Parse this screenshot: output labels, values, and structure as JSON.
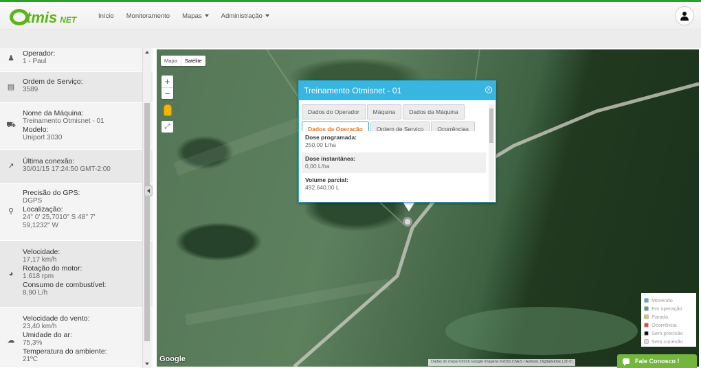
{
  "header": {
    "logo_main": "tmis",
    "logo_suffix": "NET",
    "nav": [
      {
        "label": "Início",
        "has_caret": false
      },
      {
        "label": "Monitoramento",
        "has_caret": false
      },
      {
        "label": "Mapas",
        "has_caret": true
      },
      {
        "label": "Administração",
        "has_caret": true
      }
    ],
    "user_icon": "user-icon"
  },
  "sidebar": {
    "sections": [
      {
        "icon": "operator-icon",
        "fields": [
          {
            "label": "Operador:",
            "value": "1 - Paul"
          }
        ]
      },
      {
        "icon": "document-icon",
        "fields": [
          {
            "label": "Ordem de Serviço:",
            "value": "3589"
          }
        ]
      },
      {
        "icon": "tractor-icon",
        "fields": [
          {
            "label": "Nome da Máquina:",
            "value": "Treinamento Otmisnet - 01"
          },
          {
            "label": "Modelo:",
            "value": "Uniport 3030"
          }
        ]
      },
      {
        "icon": "connection-icon",
        "fields": [
          {
            "label": "Última conexão:",
            "value": "30/01/15 17:24:50 GMT-2:00"
          }
        ]
      },
      {
        "icon": "location-pin-icon",
        "fields": [
          {
            "label": "Precisão do GPS:",
            "value": "DGPS"
          },
          {
            "label": "Localização:",
            "value": "24° 0' 25,7010\" S 48° 7' 59,1232\" W"
          }
        ]
      },
      {
        "icon": "gauge-icon",
        "fields": [
          {
            "label": "Velocidade:",
            "value": "17,17 km/h"
          },
          {
            "label": "Rotação do motor:",
            "value": "1.618 rpm"
          },
          {
            "label": "Consumo de combustível:",
            "value": "8,90 L/h"
          }
        ]
      },
      {
        "icon": "weather-icon",
        "fields": [
          {
            "label": "Velocidade do vento:",
            "value": "23,40 km/h"
          },
          {
            "label": "Umidade do ar:",
            "value": "75,3%"
          },
          {
            "label": "Temperatura do ambiente:",
            "value": "21ºC"
          }
        ]
      }
    ]
  },
  "map": {
    "type_buttons": [
      "Mapa",
      "Satélite"
    ],
    "selected_type": "Satélite",
    "zoom_in": "+",
    "zoom_out": "−",
    "google_logo": "Google",
    "attribution": "Dados do mapa ©2016 Google Imagens ©2016 CNES / Astrium, DigitalGlobe | 20 m"
  },
  "popup": {
    "title": "Treinamento Otmisnet - 01",
    "tabs_row1": [
      "Dados do Operador",
      "Máquina",
      "Dados da Máquina"
    ],
    "tabs_row2": [
      "Dados da Operação",
      "Ordem de Serviço",
      "Ocorrências"
    ],
    "active_tab": "Dados da Operação",
    "rows": [
      {
        "label": "Dose programada:",
        "value": "250,00 L/ha"
      },
      {
        "label": "Dose instantânea:",
        "value": "0,00 L/ha"
      },
      {
        "label": "Volume parcial:",
        "value": "492.640,00 L"
      }
    ]
  },
  "legend": [
    {
      "label": "Movendo",
      "color": "#3cb4e5"
    },
    {
      "label": "Em operação",
      "color": "#3bb26d"
    },
    {
      "label": "Parada",
      "color": "#f0c048"
    },
    {
      "label": "Ocorrência",
      "color": "#e04b3a"
    },
    {
      "label": "Sem precisão",
      "color": "#111111"
    },
    {
      "label": "Sem conexão",
      "color": "#dddddd"
    }
  ],
  "contact_button": "Fale Conosco !"
}
